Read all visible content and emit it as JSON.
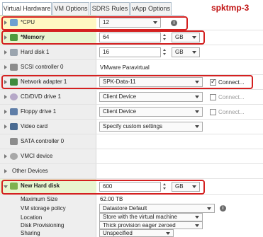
{
  "tabs": [
    "Virtual Hardware",
    "VM Options",
    "SDRS Rules",
    "vApp Options"
  ],
  "vm_name": "spktmp-3",
  "rows": {
    "cpu": {
      "label": "*CPU",
      "value": "12"
    },
    "memory": {
      "label": "*Memory",
      "value": "64",
      "unit": "GB"
    },
    "hard_disk_1": {
      "label": "Hard disk 1",
      "value": "16",
      "unit": "GB"
    },
    "scsi": {
      "label": "SCSI controller 0",
      "value": "VMware Paravirtual"
    },
    "network": {
      "label": "Network adapter 1",
      "value": "SPK-Data-11",
      "connect": "Connect..."
    },
    "cddvd": {
      "label": "CD/DVD drive 1",
      "value": "Client Device",
      "connect": "Connect..."
    },
    "floppy": {
      "label": "Floppy drive 1",
      "value": "Client Device",
      "connect": "Connect..."
    },
    "video": {
      "label": "Video card",
      "value": "Specify custom settings"
    },
    "sata": {
      "label": "SATA controller 0"
    },
    "vmci": {
      "label": "VMCI device"
    },
    "other": {
      "label": "Other Devices"
    },
    "new_disk": {
      "label": "New Hard disk",
      "value": "600",
      "unit": "GB"
    },
    "max_size": {
      "label": "Maximum Size",
      "value": "62.00 TB"
    },
    "storage_policy": {
      "label": "VM storage policy",
      "value": "Datastore Default"
    },
    "location": {
      "label": "Location",
      "value": "Store with the virtual machine"
    },
    "provisioning": {
      "label": "Disk Provisioning",
      "value": "Thick provision eager zeroed"
    },
    "sharing": {
      "label": "Sharing",
      "value": "Unspecified"
    }
  },
  "icons": {
    "cpu": "cpu-chip-icon",
    "memory": "memory-module-icon",
    "hard_disk": "hard-disk-icon",
    "scsi": "scsi-controller-icon",
    "network": "network-adapter-icon",
    "cddvd": "cd-dvd-icon",
    "floppy": "floppy-icon",
    "video": "video-card-icon",
    "sata": "sata-controller-icon",
    "vmci": "vmci-device-icon",
    "new_disk": "new-hard-disk-icon"
  },
  "colors": {
    "highlight_box": "#d42020",
    "cpu_row_bg": "#fff7c2",
    "new_disk_row_bg": "#e8f5d0"
  }
}
